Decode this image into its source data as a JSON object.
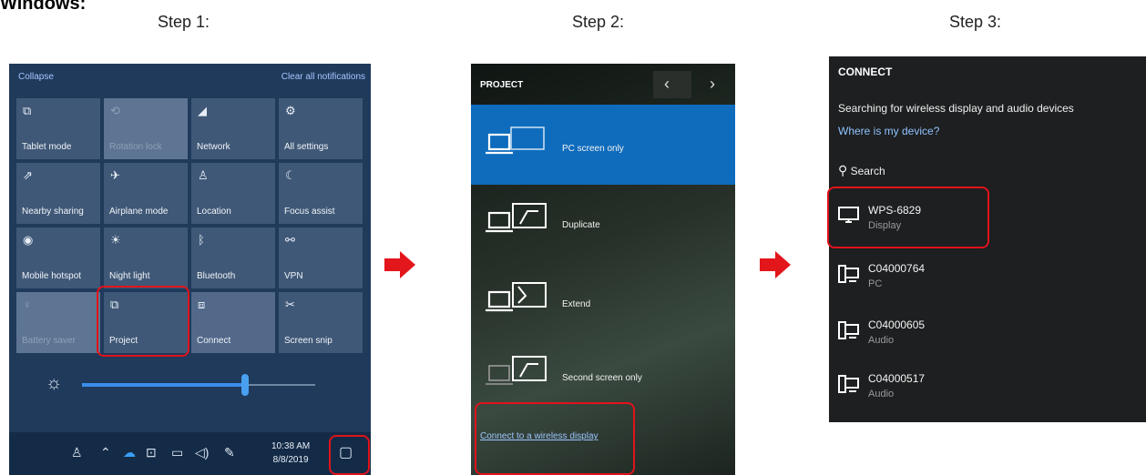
{
  "heading": "Windows:",
  "steps": [
    "Step 1:",
    "Step 2:",
    "Step 3:"
  ],
  "colors": {
    "highlight": "#e0131b",
    "arrow": "#e3161b",
    "accent": "#0f6cbd"
  },
  "action_center": {
    "collapse": "Collapse",
    "clear_all": "Clear all notifications",
    "tiles": [
      {
        "label": "Tablet mode",
        "icon": "tablet-mode-icon",
        "glyph": "⧉"
      },
      {
        "label": "Rotation lock",
        "icon": "rotation-lock-icon",
        "glyph": "⟲"
      },
      {
        "label": "Network",
        "icon": "network-icon",
        "glyph": "◢"
      },
      {
        "label": "All settings",
        "icon": "gear-icon",
        "glyph": "⚙"
      },
      {
        "label": "Nearby sharing",
        "icon": "nearby-sharing-icon",
        "glyph": "⇗"
      },
      {
        "label": "Airplane mode",
        "icon": "airplane-icon",
        "glyph": "✈"
      },
      {
        "label": "Location",
        "icon": "location-icon",
        "glyph": "♙"
      },
      {
        "label": "Focus assist",
        "icon": "moon-icon",
        "glyph": "☾"
      },
      {
        "label": "Mobile hotspot",
        "icon": "hotspot-icon",
        "glyph": "◉"
      },
      {
        "label": "Night light",
        "icon": "sun-icon",
        "glyph": "☀"
      },
      {
        "label": "Bluetooth",
        "icon": "bluetooth-icon",
        "glyph": "ᛒ"
      },
      {
        "label": "VPN",
        "icon": "vpn-icon",
        "glyph": "⚯"
      },
      {
        "label": "Battery saver",
        "icon": "battery-saver-icon",
        "glyph": "♀"
      },
      {
        "label": "Project",
        "icon": "project-icon",
        "glyph": "⧉"
      },
      {
        "label": "Connect",
        "icon": "connect-icon",
        "glyph": "⧈"
      },
      {
        "label": "Screen snip",
        "icon": "screen-snip-icon",
        "glyph": "✂"
      }
    ],
    "brightness_percent": 70,
    "clock_time": "10:38 AM",
    "clock_date": "8/8/2019"
  },
  "project": {
    "title": "PROJECT",
    "options": [
      {
        "label": "PC screen only"
      },
      {
        "label": "Duplicate"
      },
      {
        "label": "Extend"
      },
      {
        "label": "Second screen only"
      }
    ],
    "link": "Connect to a wireless display"
  },
  "connect": {
    "title": "CONNECT",
    "searching": "Searching for wireless display and audio devices",
    "where": "Where is my device?",
    "search": "Search",
    "devices": [
      {
        "name": "WPS-6829",
        "type": "Display",
        "icon": "monitor-icon"
      },
      {
        "name": "C04000764",
        "type": "PC",
        "icon": "pc-icon"
      },
      {
        "name": "C04000605",
        "type": "Audio",
        "icon": "pc-icon"
      },
      {
        "name": "C04000517",
        "type": "Audio",
        "icon": "pc-icon"
      }
    ]
  }
}
